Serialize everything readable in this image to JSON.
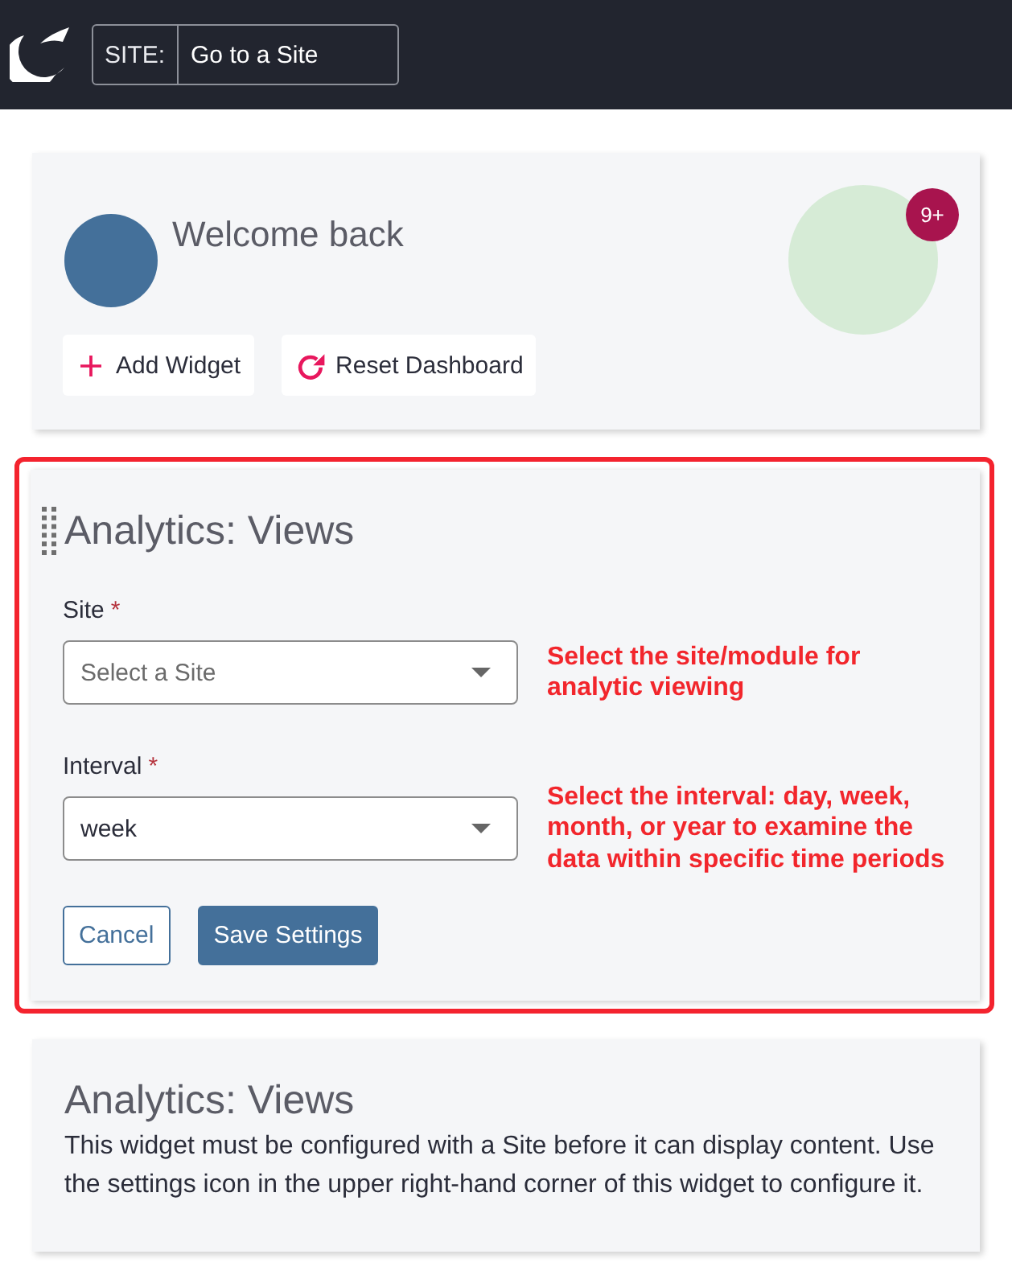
{
  "top_bar": {
    "site_label": "SITE:",
    "site_value": "Go to a Site"
  },
  "welcome_card": {
    "greeting": "Welcome back",
    "notification_badge": "9+",
    "buttons": [
      {
        "kind": "add",
        "label": "Add Widget"
      },
      {
        "kind": "reset",
        "label": "Reset Dashboard"
      }
    ]
  },
  "settings_widget": {
    "highlighted": true,
    "title": "Analytics: Views",
    "fields": [
      {
        "label": "Site",
        "required_mark": "*",
        "placeholder": "Select a Site",
        "annotation": "Select the site/module for analytic viewing"
      },
      {
        "label": "Interval",
        "required_mark": "*",
        "value": "week",
        "annotation": "Select the interval: day, week, month, or year to examine the data within specific time periods"
      }
    ],
    "buttons": [
      {
        "kind": "secondary",
        "label": "Cancel"
      },
      {
        "kind": "primary",
        "label": "Save Settings"
      }
    ]
  },
  "info_widget": {
    "title": "Analytics: Views",
    "message": "This widget must be configured with a Site before it can display content. Use the settings icon in the upper right-hand corner of this widget to configure it."
  }
}
